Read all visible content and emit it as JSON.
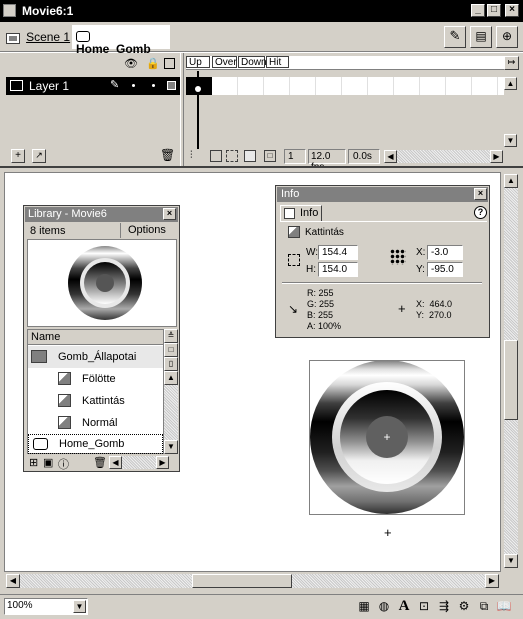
{
  "window": {
    "title": "Movie6:1",
    "min": "_",
    "max": "□",
    "close": "×"
  },
  "scenebar": {
    "scene_label": "Scene 1",
    "symbol_label": "Home_Gomb"
  },
  "timeline": {
    "layer_name": "Layer 1",
    "frame_labels": [
      "Up",
      "Over",
      "Down",
      "Hit"
    ],
    "current_frame": "1",
    "fps": "12.0 fps",
    "time": "0.0s"
  },
  "info_panel": {
    "title": "Info",
    "tab": "Info",
    "object_name": "Kattintás",
    "w_label": "W:",
    "w": "154.4",
    "h_label": "H:",
    "h": "154.0",
    "x_label": "X:",
    "x": "-3.0",
    "y_label": "Y:",
    "y": "-95.0",
    "r": "R: 255",
    "g": "G: 255",
    "b": "B: 255",
    "a": "A: 100%",
    "cx": "X:  464.0",
    "cy": "Y:  270.0"
  },
  "library_panel": {
    "title": "Library - Movie6",
    "items_count": "8 items",
    "options": "Options",
    "column_name": "Name",
    "items": [
      {
        "label": "Gomb_Állapotai",
        "icon": "folder-icon"
      },
      {
        "label": "Fölötte",
        "icon": "graphic-symbol-icon"
      },
      {
        "label": "Kattintás",
        "icon": "graphic-symbol-icon"
      },
      {
        "label": "Normál",
        "icon": "graphic-symbol-icon"
      },
      {
        "label": "Home_Gomb",
        "icon": "button-symbol-icon"
      }
    ]
  },
  "status": {
    "zoom": "100%"
  }
}
